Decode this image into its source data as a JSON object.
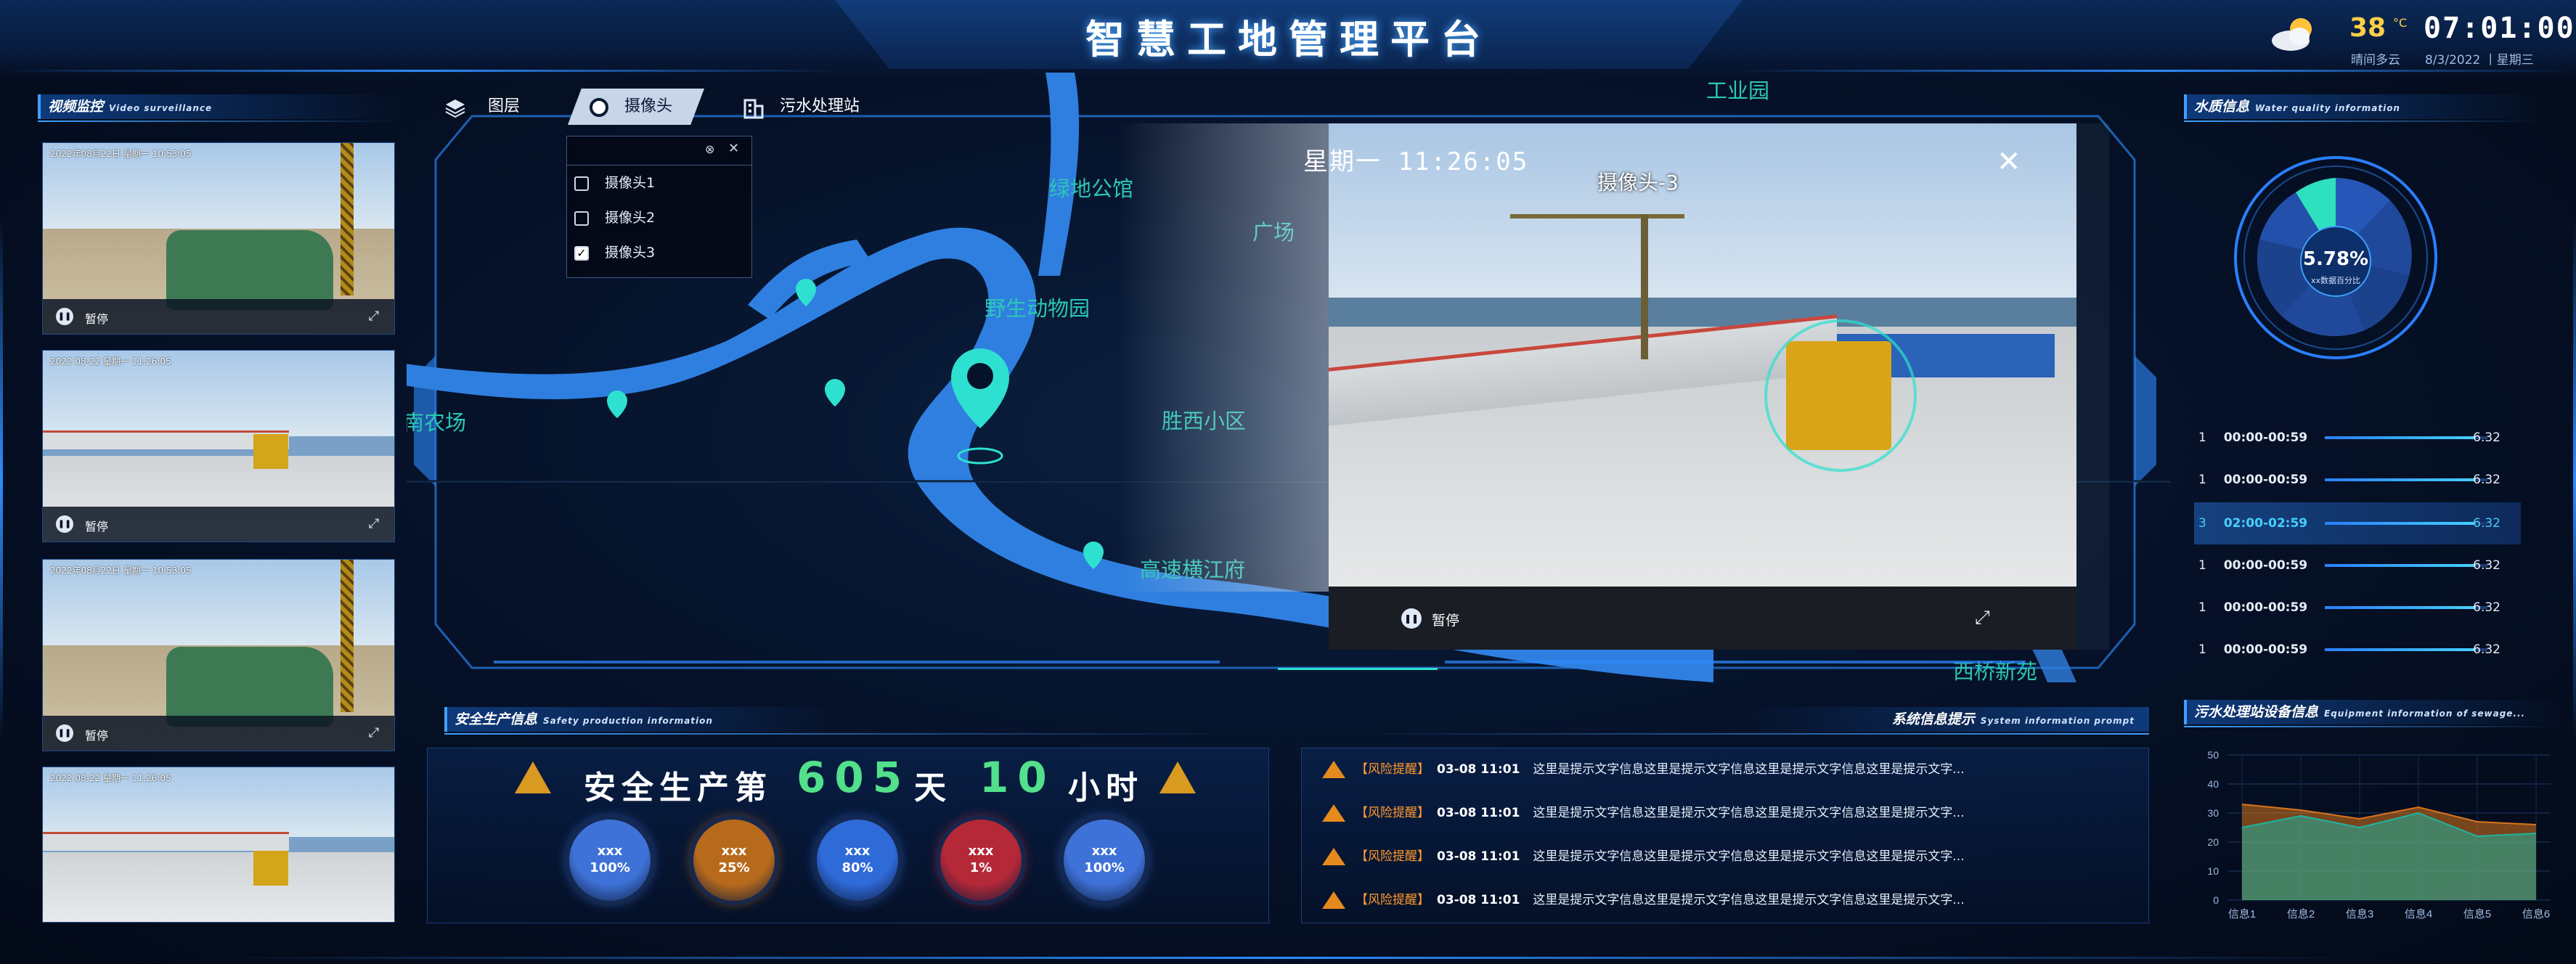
{
  "header": {
    "title": "智慧工地管理平台"
  },
  "weather": {
    "temp": "38",
    "unit": "°C",
    "desc": "晴间多云",
    "time": "07:01:00",
    "date": "8/3/2022 丨星期三",
    "icon": "partly-cloudy-icon"
  },
  "video_panel": {
    "title": "视频监控",
    "subtitle": "Video surveillance",
    "videos": [
      {
        "stamp": "2022年08月22日 星期一 10:53:05",
        "pause": "暂停"
      },
      {
        "stamp": "2022 08-22 星期一 11:26:05",
        "pause": "暂停"
      },
      {
        "stamp": "2022年08月22日 星期一 10:53:05",
        "pause": "暂停"
      },
      {
        "stamp": "2022 08-22 星期一 11:26:05",
        "pause": "暂停"
      }
    ]
  },
  "map": {
    "tabs": [
      "图层",
      "摄像头",
      "污水处理站"
    ],
    "camera_options": [
      {
        "label": "摄像头1",
        "checked": false
      },
      {
        "label": "摄像头2",
        "checked": false
      },
      {
        "label": "摄像头3",
        "checked": true
      }
    ],
    "places": [
      "工业园",
      "绿地公馆",
      "广场",
      "野生动物园",
      "胜西小区",
      "高速横江府",
      "南农场",
      "西桥新苑"
    ]
  },
  "popup": {
    "camera_name": "摄像头-3",
    "time": "星期一 11:26:05",
    "pause": "暂停",
    "close": "×"
  },
  "safety": {
    "title": "安全生产信息",
    "subtitle": "Safety production information",
    "prefix": "安全生产第",
    "days": "605",
    "day_unit": "天",
    "hours": "10",
    "hour_unit": "小时",
    "circles": [
      {
        "label": "xxx",
        "value": "100%",
        "color": "#3f72d8"
      },
      {
        "label": "xxx",
        "value": "25%",
        "color": "#b86a1c"
      },
      {
        "label": "xxx",
        "value": "80%",
        "color": "#2f6ad9"
      },
      {
        "label": "xxx",
        "value": "1%",
        "color": "#b52838"
      },
      {
        "label": "xxx",
        "value": "100%",
        "color": "#3f72d8"
      }
    ]
  },
  "system": {
    "title": "系统信息提示",
    "subtitle": "System information prompt",
    "alerts": [
      {
        "tag": "【风险提醒】",
        "time": "03-08 11:01",
        "text": "这里是提示文字信息这里是提示文字信息这里是提示文字信息这里是提示文字..."
      },
      {
        "tag": "【风险提醒】",
        "time": "03-08 11:01",
        "text": "这里是提示文字信息这里是提示文字信息这里是提示文字信息这里是提示文字..."
      },
      {
        "tag": "【风险提醒】",
        "time": "03-08 11:01",
        "text": "这里是提示文字信息这里是提示文字信息这里是提示文字信息这里是提示文字..."
      },
      {
        "tag": "【风险提醒】",
        "time": "03-08 11:01",
        "text": "这里是提示文字信息这里是提示文字信息这里是提示文字信息这里是提示文字..."
      }
    ]
  },
  "water": {
    "title": "水质信息",
    "subtitle": "Water quality information",
    "gauge_value": "5.78%",
    "gauge_label": "xx数据百分比",
    "rows": [
      {
        "rank": "1",
        "range": "00:00-00:59",
        "value": "6.32",
        "fill": 0.92
      },
      {
        "rank": "1",
        "range": "00:00-00:59",
        "value": "6.32",
        "fill": 0.92
      },
      {
        "rank": "3",
        "range": "02:00-02:59",
        "value": "6.32",
        "fill": 0.92,
        "selected": true
      },
      {
        "rank": "1",
        "range": "00:00-00:59",
        "value": "6.32",
        "fill": 0.92
      },
      {
        "rank": "1",
        "range": "00:00-00:59",
        "value": "6.32",
        "fill": 0.92
      },
      {
        "rank": "1",
        "range": "00:00-00:59",
        "value": "6.32",
        "fill": 0.92
      }
    ]
  },
  "equipment": {
    "title": "污水处理站设备信息",
    "subtitle": "Equipment information of sewage..."
  },
  "chart_data": {
    "type": "area",
    "categories": [
      "信息1",
      "信息2",
      "信息3",
      "信息4",
      "信息5",
      "信息6"
    ],
    "ylim": [
      0,
      50
    ],
    "yticks": [
      0,
      10,
      20,
      30,
      40,
      50
    ],
    "series": [
      {
        "values": [
          33,
          31,
          28,
          32,
          27,
          26
        ],
        "color": "#d9741c"
      },
      {
        "values": [
          25,
          29,
          25,
          30,
          22,
          23
        ],
        "color": "#1fb3a0"
      }
    ]
  }
}
